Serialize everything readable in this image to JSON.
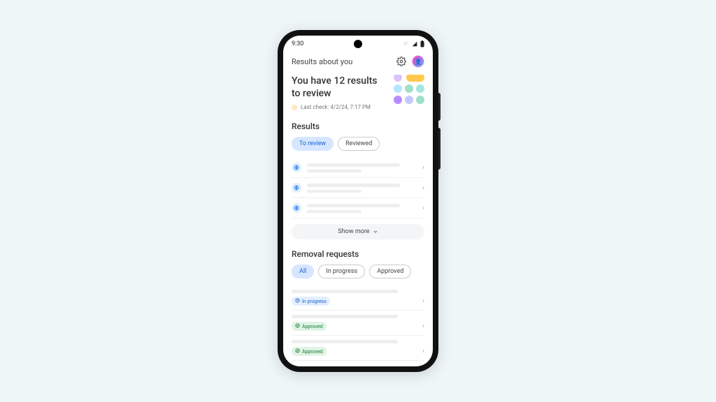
{
  "status": {
    "time": "9:30"
  },
  "header": {
    "title": "Results about you"
  },
  "hero": {
    "title_line1": "You have 12 results",
    "title_line2": "to review",
    "last_check": "Last check: 4/2/24, 7:17 PM"
  },
  "dots": [
    {
      "color": "#d9c2ff"
    },
    {
      "color": "#ffc94d",
      "pill": true
    },
    {
      "color": "#b6e5ff"
    },
    {
      "color": "#9fe0c9"
    },
    {
      "color": "#a5e6e0"
    },
    {
      "color": "#b78bff"
    },
    {
      "color": "#c2c9ff"
    },
    {
      "color": "#9fe0c9"
    }
  ],
  "results": {
    "title": "Results",
    "chips": [
      {
        "label": "To review",
        "active": true
      },
      {
        "label": "Reviewed",
        "active": false
      }
    ],
    "show_more": "Show more"
  },
  "removal": {
    "title": "Removal requests",
    "chips": [
      {
        "label": "All",
        "active": true
      },
      {
        "label": "In progress",
        "active": false
      },
      {
        "label": "Approved",
        "active": false
      }
    ],
    "rows": [
      {
        "status": "In progress",
        "kind": "prog"
      },
      {
        "status": "Approved",
        "kind": "appr"
      },
      {
        "status": "Approved",
        "kind": "appr"
      }
    ]
  }
}
